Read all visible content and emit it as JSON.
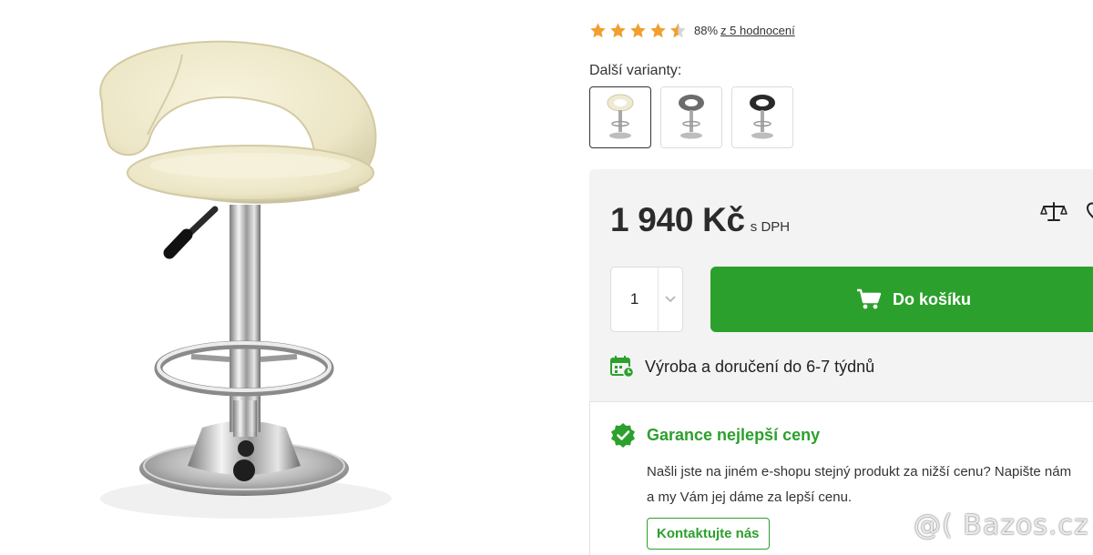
{
  "product": {
    "image_alt": "Barová židle krémová"
  },
  "rating": {
    "stars": 4.5,
    "max_stars": 5,
    "percent": "88%",
    "reviews_link": "z 5 hodnocení",
    "star_color": "#f0a030"
  },
  "variants": {
    "label": "Další varianty:",
    "items": [
      {
        "name": "krémová",
        "color": "#efead3",
        "selected": true
      },
      {
        "name": "šedá",
        "color": "#6c6c6c",
        "selected": false
      },
      {
        "name": "černá",
        "color": "#2a2a2a",
        "selected": false
      }
    ]
  },
  "buy_box": {
    "price": "1 940 Kč",
    "price_note": "s DPH",
    "quantity": "1",
    "add_to_cart_label": "Do košíku",
    "delivery_text": "Výroba a doručení do 6-7 týdnů",
    "accent_color": "#2ca02c",
    "background_color": "#f3f3f3"
  },
  "guarantee": {
    "title": "Garance nejlepší ceny",
    "text_line1": "Našli jste na jiném e-shopu stejný produkt za nižší cenu? Napište nám",
    "text_line2": "a my Vám jej dáme za lepší cenu.",
    "contact_label": "Kontaktujte nás"
  },
  "watermark": {
    "text": "@( Bazos.cz"
  }
}
